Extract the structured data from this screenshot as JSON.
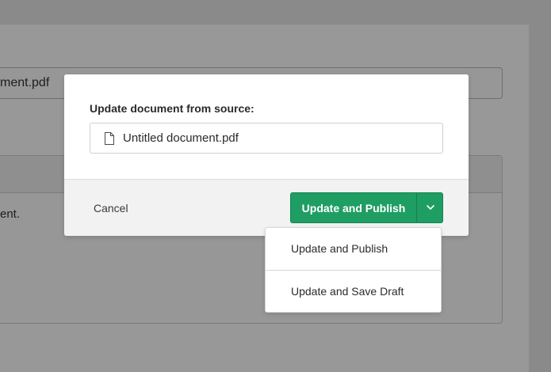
{
  "background": {
    "file_name_partial": "ment.pdf",
    "panel_text_partial": "ent."
  },
  "modal": {
    "label": "Update document from source:",
    "source_field": {
      "icon": "document-icon",
      "value": "Untitled document.pdf"
    },
    "footer": {
      "cancel_label": "Cancel",
      "primary_label": "Update and Publish",
      "toggle_icon": "chevron-down-icon"
    }
  },
  "dropdown": {
    "items": [
      {
        "label": "Update and Publish"
      },
      {
        "label": "Update and Save Draft"
      }
    ]
  },
  "colors": {
    "primary": "#1e9e63",
    "overlay": "#8a8a8a",
    "footer_bg": "#f2f2f2"
  }
}
